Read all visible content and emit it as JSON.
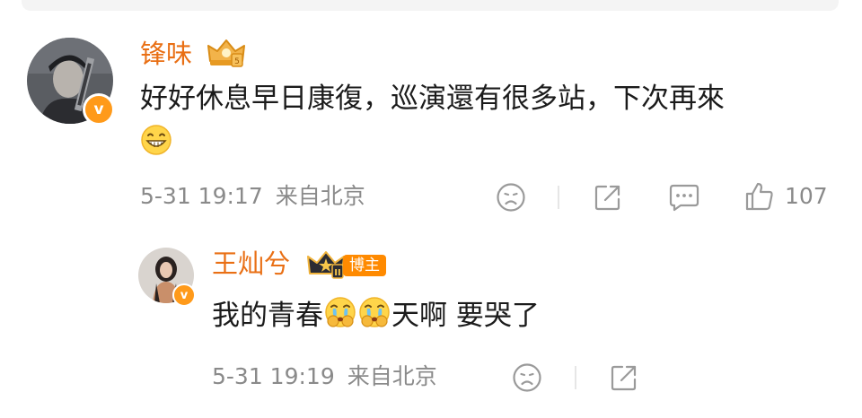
{
  "comments": [
    {
      "username": "锋味",
      "text_line1": "好好休息早日康復，巡演還有很多站，下次再來",
      "emoji": "grinning-face",
      "date": "5-31 19:17",
      "location": "来自北京",
      "likes": "107"
    },
    {
      "username": "王灿兮",
      "badge_label": "博主",
      "text_part1": "我的青春",
      "emoji": "crying-face",
      "text_part2": "天啊 要哭了",
      "date": "5-31 19:19",
      "location": "来自北京"
    }
  ],
  "colors": {
    "username": "#e96f14",
    "verified_badge": "#ff9a1a",
    "blogger_badge": "#ff8a00",
    "meta_text": "#8a8a8a",
    "icon": "#9a9a9a"
  }
}
